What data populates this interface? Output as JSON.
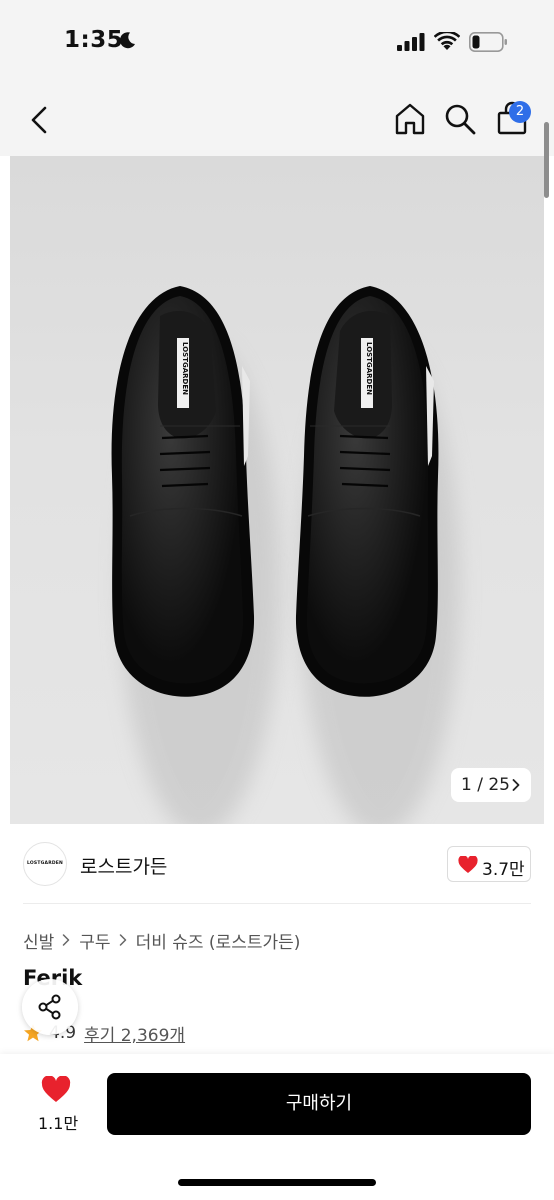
{
  "status_bar": {
    "time": "1:35"
  },
  "nav": {
    "cart_badge": "2"
  },
  "gallery": {
    "counter": "1 / 25",
    "label_left": "LOSTGARDEN",
    "label_right": "LOSTGARDEN"
  },
  "brand": {
    "logo_text": "LOSTGARDEN",
    "name": "로스트가든",
    "like_count": "3.7만"
  },
  "breadcrumb": {
    "items": [
      "신발",
      "구두",
      "더비 슈즈 (로스트가든)"
    ]
  },
  "product": {
    "title": "Ferik",
    "rating": "4.9",
    "reviews": "후기 2,369개"
  },
  "bottom": {
    "wish_count": "1.1만",
    "buy_label": "구매하기"
  },
  "colors": {
    "accent_badge": "#2f6ee8",
    "heart": "#e8222d",
    "star": "#f6a623",
    "buy_button": "#000000"
  },
  "icons": [
    "moon-icon",
    "signal-icon",
    "wifi-icon",
    "battery-icon",
    "back-icon",
    "home-icon",
    "search-icon",
    "cart-icon",
    "chevron-right-icon",
    "heart-icon",
    "star-icon",
    "share-icon"
  ]
}
